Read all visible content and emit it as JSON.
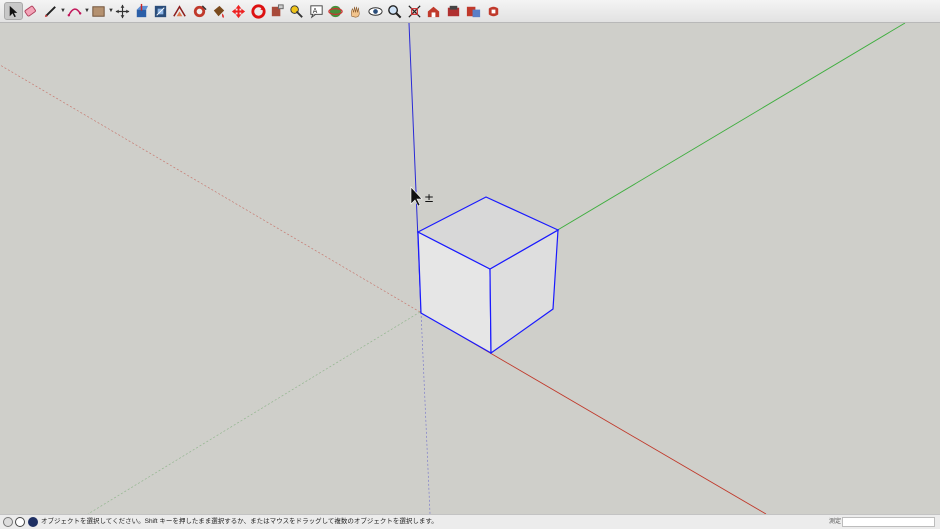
{
  "toolbar": {
    "tools": [
      {
        "name": "select-tool-icon",
        "active": true
      },
      {
        "name": "eraser-tool-icon"
      },
      {
        "name": "pencil-line-tool-icon",
        "dropdown": true
      },
      {
        "name": "arc-tool-icon",
        "dropdown": true
      },
      {
        "name": "rectangle-tool-icon",
        "dropdown": true
      },
      {
        "name": "move-tool-icon"
      },
      {
        "name": "push-pull-tool-icon"
      },
      {
        "name": "scale-tool-icon"
      },
      {
        "name": "offset-tool-icon"
      },
      {
        "name": "follow-me-tool-icon"
      },
      {
        "name": "paint-bucket-tool-icon"
      },
      {
        "name": "move-arrows-tool-icon"
      },
      {
        "name": "rotate-tool-icon"
      },
      {
        "name": "tape-measure-tool-icon"
      },
      {
        "name": "dimension-tool-icon"
      },
      {
        "name": "text-tool-icon"
      },
      {
        "name": "orbit-tool-icon"
      },
      {
        "name": "pan-tool-icon"
      },
      {
        "name": "look-around-tool-icon"
      },
      {
        "name": "zoom-tool-icon"
      },
      {
        "name": "zoom-extents-tool-icon"
      },
      {
        "name": "warehouse-tool-icon"
      },
      {
        "name": "extension-warehouse-tool-icon"
      },
      {
        "name": "send-to-layout-tool-icon"
      },
      {
        "name": "extension-manager-tool-icon"
      }
    ]
  },
  "viewport": {
    "axis_colors": {
      "red": "#c0392b",
      "green": "#3fae3f",
      "blue": "#2a2ad6"
    },
    "selection_color": "#1a1aff",
    "cursor": "select-add-cursor-icon",
    "cursor_modifier": "±"
  },
  "statusbar": {
    "message": "オブジェクトを選択してください。Shift キーを押したまま選択するか、またはマウスをドラッグして複数のオブジェクトを選択します。",
    "measurement_label": "測定",
    "measurement_value": ""
  }
}
